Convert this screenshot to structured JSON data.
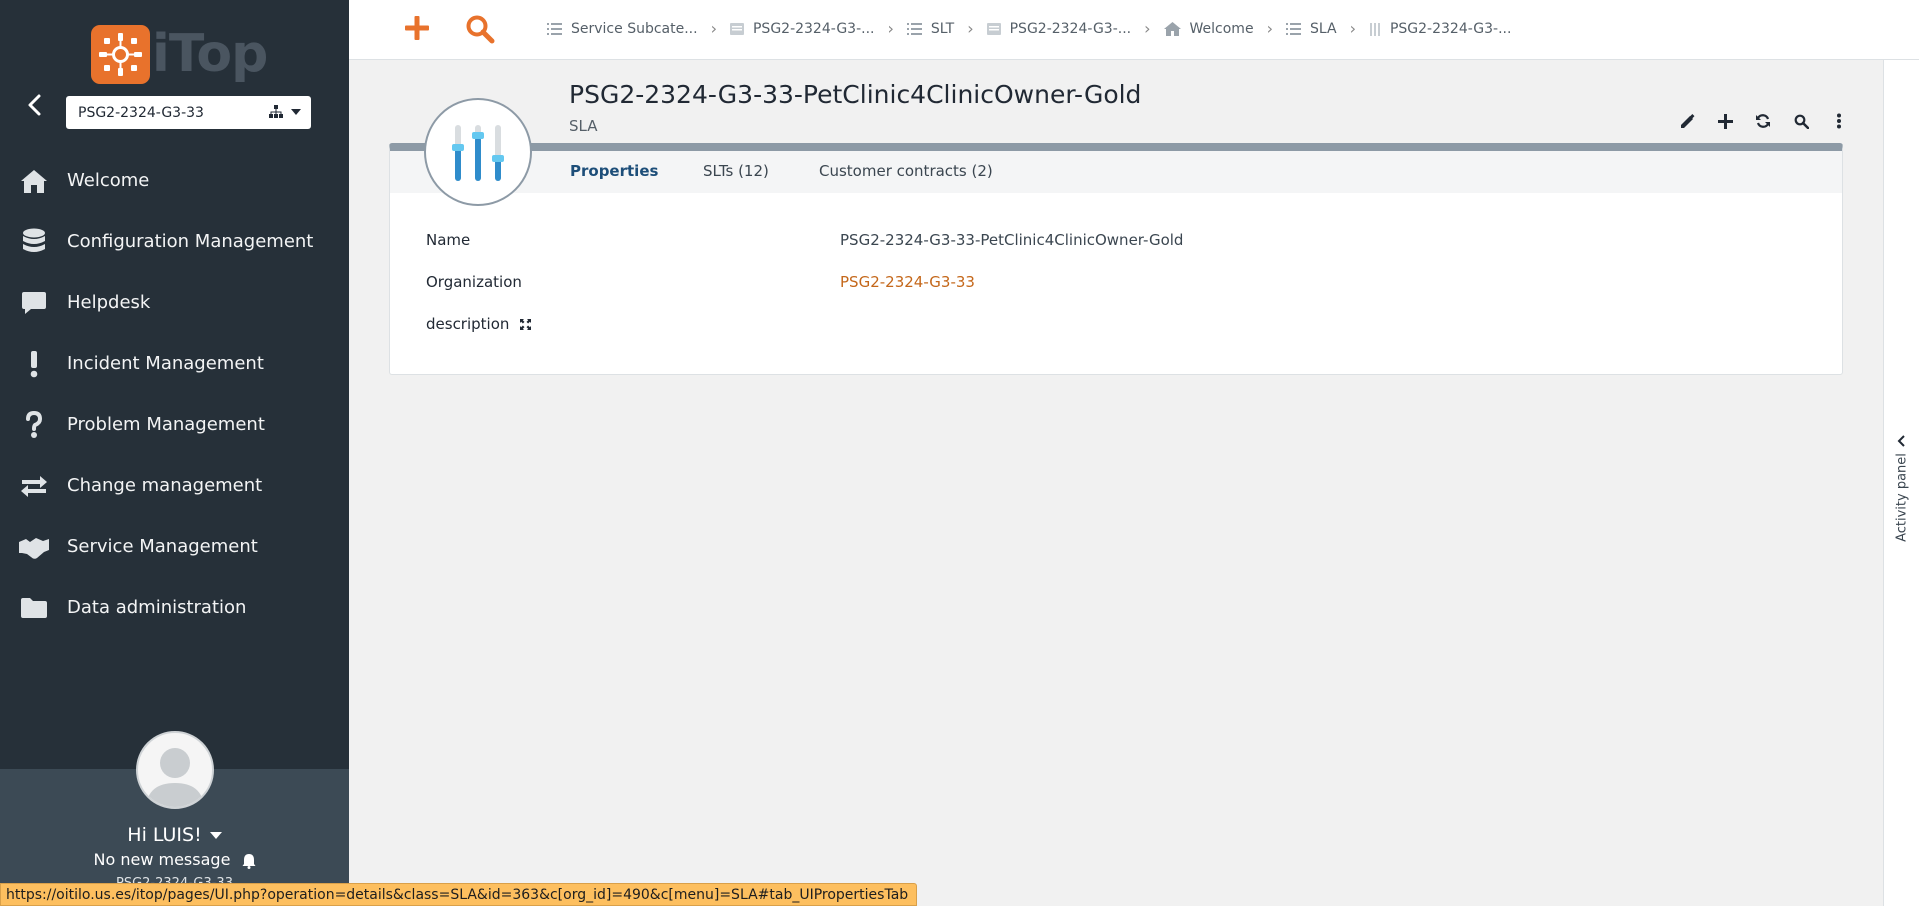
{
  "app": {
    "logo_text": "iTop",
    "org_selector": "PSG2-2324-G3-33"
  },
  "sidebar": {
    "items": [
      {
        "label": "Welcome",
        "icon": "home-icon"
      },
      {
        "label": "Configuration Management",
        "icon": "database-icon"
      },
      {
        "label": "Helpdesk",
        "icon": "comment-icon"
      },
      {
        "label": "Incident Management",
        "icon": "exclamation-icon"
      },
      {
        "label": "Problem Management",
        "icon": "question-icon"
      },
      {
        "label": "Change management",
        "icon": "exchange-icon"
      },
      {
        "label": "Service Management",
        "icon": "handshake-icon"
      },
      {
        "label": "Data administration",
        "icon": "folder-icon"
      }
    ],
    "user": {
      "greeting": "Hi LUIS!",
      "messages": "No new message",
      "org": "PSG2-2324-G3-33"
    }
  },
  "breadcrumbs": [
    {
      "label": "Service Subcate...",
      "icon": "list-icon"
    },
    {
      "label": "PSG2-2324-G3-...",
      "icon": "document-icon"
    },
    {
      "label": "SLT",
      "icon": "list-icon"
    },
    {
      "label": "PSG2-2324-G3-...",
      "icon": "document-icon"
    },
    {
      "label": "Welcome",
      "icon": "home-icon"
    },
    {
      "label": "SLA",
      "icon": "list-icon"
    },
    {
      "label": "PSG2-2324-G3-...",
      "icon": "sliders-icon"
    }
  ],
  "object": {
    "title": "PSG2-2324-G3-33-PetClinic4ClinicOwner-Gold",
    "class": "SLA",
    "tabs": [
      {
        "label": "Properties",
        "active": true
      },
      {
        "label": "SLTs (12)",
        "active": false
      },
      {
        "label": "Customer contracts (2)",
        "active": false
      }
    ],
    "fields": {
      "name_label": "Name",
      "name_value": "PSG2-2324-G3-33-PetClinic4ClinicOwner-Gold",
      "org_label": "Organization",
      "org_value": "PSG2-2324-G3-33",
      "description_label": "description"
    }
  },
  "activity_panel": {
    "label": "Activity panel"
  },
  "statusbar": {
    "url": "https://oitilo.us.es/itop/pages/UI.php?operation=details&class=SLA&id=363&c[org_id]=490&c[menu]=SLA#tab_UIPropertiesTab"
  },
  "colors": {
    "sidebar_bg": "#263039",
    "accent_orange": "#e8722c",
    "link_orange": "#c4671a",
    "card_header": "#8d9aa6",
    "active_tab": "#1d4e79",
    "statusbar_bg": "#fdbf5f"
  }
}
